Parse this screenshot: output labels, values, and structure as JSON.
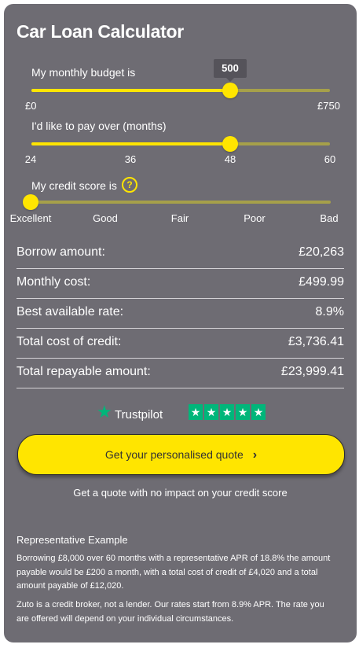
{
  "title": "Car Loan Calculator",
  "budget": {
    "label": "My monthly budget is",
    "value": "500",
    "min_label": "£0",
    "max_label": "£750",
    "min": 0,
    "max": 750,
    "current": 500
  },
  "term": {
    "label": "I'd like to pay over (months)",
    "ticks": [
      "24",
      "36",
      "48",
      "60"
    ],
    "selected": "48"
  },
  "credit": {
    "label": "My credit score is",
    "help_icon": "?",
    "ticks": [
      "Excellent",
      "Good",
      "Fair",
      "Poor",
      "Bad"
    ],
    "selected": "Excellent"
  },
  "results": [
    {
      "label": "Borrow amount:",
      "value": "£20,263"
    },
    {
      "label": "Monthly cost:",
      "value": "£499.99"
    },
    {
      "label": "Best available rate:",
      "value": "8.9%"
    },
    {
      "label": "Total cost of credit:",
      "value": "£3,736.41"
    },
    {
      "label": "Total repayable amount:",
      "value": "£23,999.41"
    }
  ],
  "trustpilot": {
    "label": "Trustpilot",
    "rating": 5
  },
  "cta": {
    "label": "Get your personalised quote",
    "chevron": "›"
  },
  "no_impact": "Get a quote with no impact on your credit score",
  "representative": {
    "heading": "Representative Example",
    "body": "Borrowing £8,000 over 60 months with a representative APR of 18.8% the amount payable would be £200 a month, with a total cost of credit of £4,020 and a total amount payable of £12,020.",
    "disclaimer": "Zuto is a credit broker, not a lender. Our rates start from 8.9% APR. The rate you are offered will depend on your individual circumstances."
  },
  "colors": {
    "accent": "#ffe500",
    "panel": "#6e6c73",
    "trustpilot": "#00b67a"
  }
}
